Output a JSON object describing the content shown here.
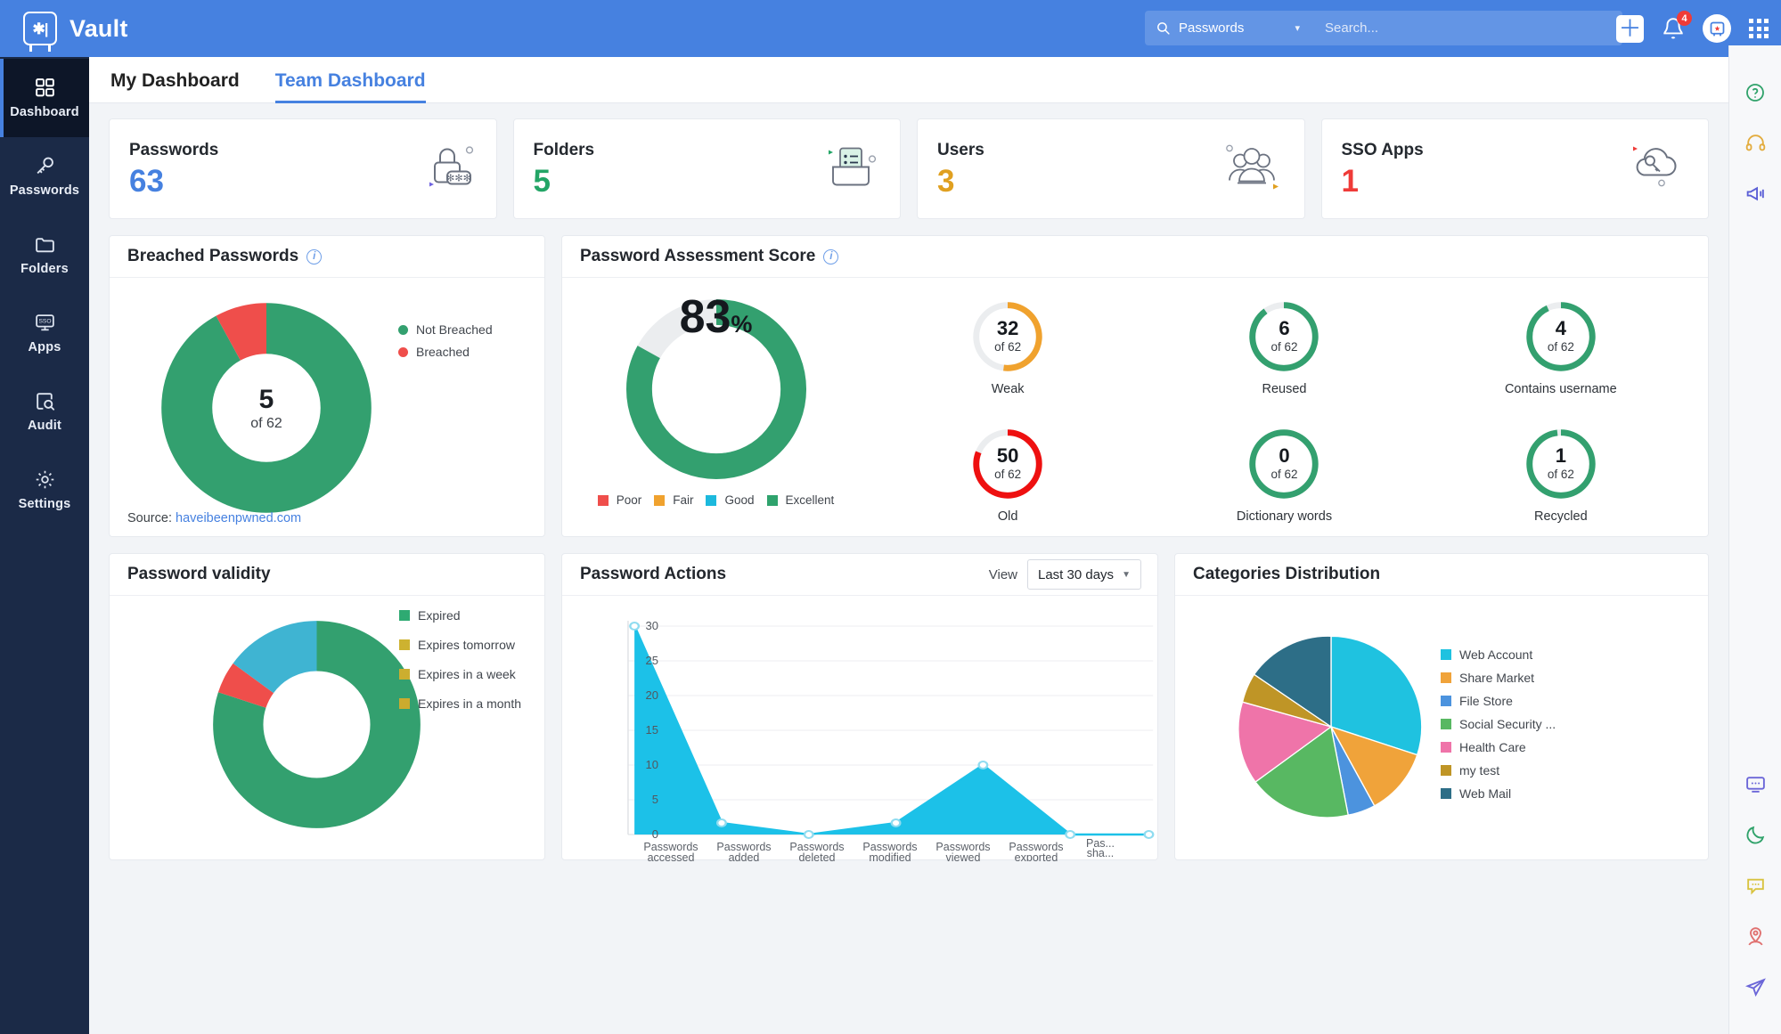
{
  "app": {
    "name": "Vault",
    "logo_icon": "vault-safe-icon"
  },
  "header": {
    "scope_label": "Passwords",
    "scope_icon": "search-icon",
    "chevron_icon": "chevron-down-icon",
    "search_placeholder": "Search...",
    "search_value": "",
    "add_icon": "plus-icon",
    "notifications_icon": "bell-icon",
    "notifications_count": "4",
    "avatar_icon": "vault-avatar-icon",
    "apps_icon": "app-grid-icon"
  },
  "sidebar": {
    "items": [
      {
        "label": "Dashboard",
        "icon": "dashboard-grid-icon",
        "active": true
      },
      {
        "label": "Passwords",
        "icon": "key-icon",
        "active": false
      },
      {
        "label": "Folders",
        "icon": "folder-icon",
        "active": false
      },
      {
        "label": "Apps",
        "icon": "sso-monitor-icon",
        "active": false
      },
      {
        "label": "Audit",
        "icon": "audit-search-icon",
        "active": false
      },
      {
        "label": "Settings",
        "icon": "gear-icon",
        "active": false
      }
    ]
  },
  "right_rail": {
    "items": [
      {
        "icon": "help-question-icon",
        "color": "#2fa26a"
      },
      {
        "icon": "headset-support-icon",
        "color": "#e3ac3e"
      },
      {
        "icon": "megaphone-announcement-icon",
        "color": "#5b5fd6"
      },
      {
        "icon": "chat-monitor-icon",
        "color": "#6b66d8"
      },
      {
        "icon": "moon-darkmode-icon",
        "color": "#2fa26a"
      },
      {
        "icon": "feedback-bubble-icon",
        "color": "#d8c33f"
      },
      {
        "icon": "user-location-icon",
        "color": "#e0706f"
      },
      {
        "icon": "send-telegram-icon",
        "color": "#6b66d8"
      }
    ]
  },
  "tabs": [
    {
      "label": "My Dashboard",
      "selected": false
    },
    {
      "label": "Team Dashboard",
      "selected": true
    }
  ],
  "kpis": [
    {
      "title": "Passwords",
      "value": "63",
      "color": "#4681e0",
      "icon": "padlock-asterisks-icon"
    },
    {
      "title": "Folders",
      "value": "5",
      "color": "#23a566",
      "icon": "folder-list-icon"
    },
    {
      "title": "Users",
      "value": "3",
      "color": "#e0a020",
      "icon": "users-group-icon"
    },
    {
      "title": "SSO Apps",
      "value": "1",
      "color": "#ef3b38",
      "icon": "cloud-key-icon"
    }
  ],
  "breached": {
    "title": "Breached Passwords",
    "info_icon": "info-icon",
    "center_value": "5",
    "center_sub": "of 62",
    "source_label": "Source:",
    "source_link": "haveibeenpwned.com",
    "chart_data": {
      "type": "pie",
      "title": "Breached Passwords",
      "labels": [
        "Not Breached",
        "Breached"
      ],
      "values": [
        57,
        5
      ],
      "colors": [
        "#33a06f",
        "#ef4e4b"
      ],
      "donut": true,
      "legend": "right"
    }
  },
  "assessment": {
    "title": "Password Assessment Score",
    "info_icon": "info-icon",
    "score_value": "83",
    "score_unit": "%",
    "legend": [
      {
        "label": "Poor",
        "color": "#ef4e4b"
      },
      {
        "label": "Fair",
        "color": "#f0a22e"
      },
      {
        "label": "Good",
        "color": "#1cb9dd"
      },
      {
        "label": "Excellent",
        "color": "#2fa36d"
      }
    ],
    "metrics": [
      {
        "label": "Weak",
        "value": "32",
        "of": "of 62",
        "pct": 52,
        "color": "#f0a22e"
      },
      {
        "label": "Reused",
        "value": "6",
        "of": "of 62",
        "pct": 90,
        "color": "#33a06f"
      },
      {
        "label": "Contains username",
        "value": "4",
        "of": "of 62",
        "pct": 93,
        "color": "#33a06f"
      },
      {
        "label": "Old",
        "value": "50",
        "of": "of 62",
        "pct": 81,
        "color": "#ee1010"
      },
      {
        "label": "Dictionary words",
        "value": "0",
        "of": "of 62",
        "pct": 100,
        "color": "#33a06f"
      },
      {
        "label": "Recycled",
        "value": "1",
        "of": "of 62",
        "pct": 98,
        "color": "#33a06f"
      }
    ],
    "chart_data": {
      "type": "pie",
      "title": "Password Assessment Score",
      "labels": [
        "Excellent",
        "Remaining"
      ],
      "values": [
        83,
        17
      ],
      "colors": [
        "#33a06f",
        "#ebedef"
      ],
      "donut": true,
      "center_label": "83%"
    }
  },
  "validity": {
    "title": "Password validity",
    "chart_data": {
      "type": "pie",
      "title": "Password validity",
      "labels": [
        "Expired",
        "Expires tomorrow",
        "Expires in a week",
        "Expires in a month"
      ],
      "values": [
        80,
        3,
        5,
        12
      ],
      "colors": [
        "#33a06f",
        "#d1b430",
        "#cfa92e",
        "#c9a52d"
      ],
      "legend_colors": [
        "#2eaa72",
        "#cdb230",
        "#ccae2f",
        "#cbab2e"
      ],
      "donut": true,
      "legend": "right",
      "slice_colors_drawn": [
        "#33a06f",
        "#ef4e4b",
        "#3fb4d2"
      ]
    }
  },
  "actions": {
    "title": "Password Actions",
    "view_label": "View",
    "view_value": "Last 30 days",
    "caret_icon": "chevron-down-icon",
    "chart_data": {
      "type": "area",
      "title": "Password Actions",
      "categories": [
        "Passwords accessed",
        "Passwords added",
        "Passwords deleted",
        "Passwords modified",
        "Passwords viewed",
        "Passwords exported",
        "Pas... sha... upd..."
      ],
      "values": [
        30,
        1,
        0,
        1,
        10,
        0,
        0
      ],
      "yticks": [
        0,
        5,
        10,
        15,
        20,
        25,
        30
      ],
      "ylim": [
        0,
        30
      ],
      "color": "#1cc1e8",
      "grid": true,
      "xlabel": "",
      "ylabel": ""
    }
  },
  "categories": {
    "title": "Categories Distribution",
    "chart_data": {
      "type": "pie",
      "title": "Categories Distribution",
      "labels": [
        "Web Account",
        "Share Market",
        "File Store",
        "Social Security ...",
        "Health Care",
        "my test",
        "Web Mail"
      ],
      "values": [
        30,
        13,
        6,
        18,
        16,
        4,
        13
      ],
      "colors": [
        "#1fc2e0",
        "#f0a33a",
        "#4c93de",
        "#58b862",
        "#ef74a9",
        "#bf9526",
        "#2d6e87"
      ],
      "donut": false,
      "legend": "right"
    }
  }
}
